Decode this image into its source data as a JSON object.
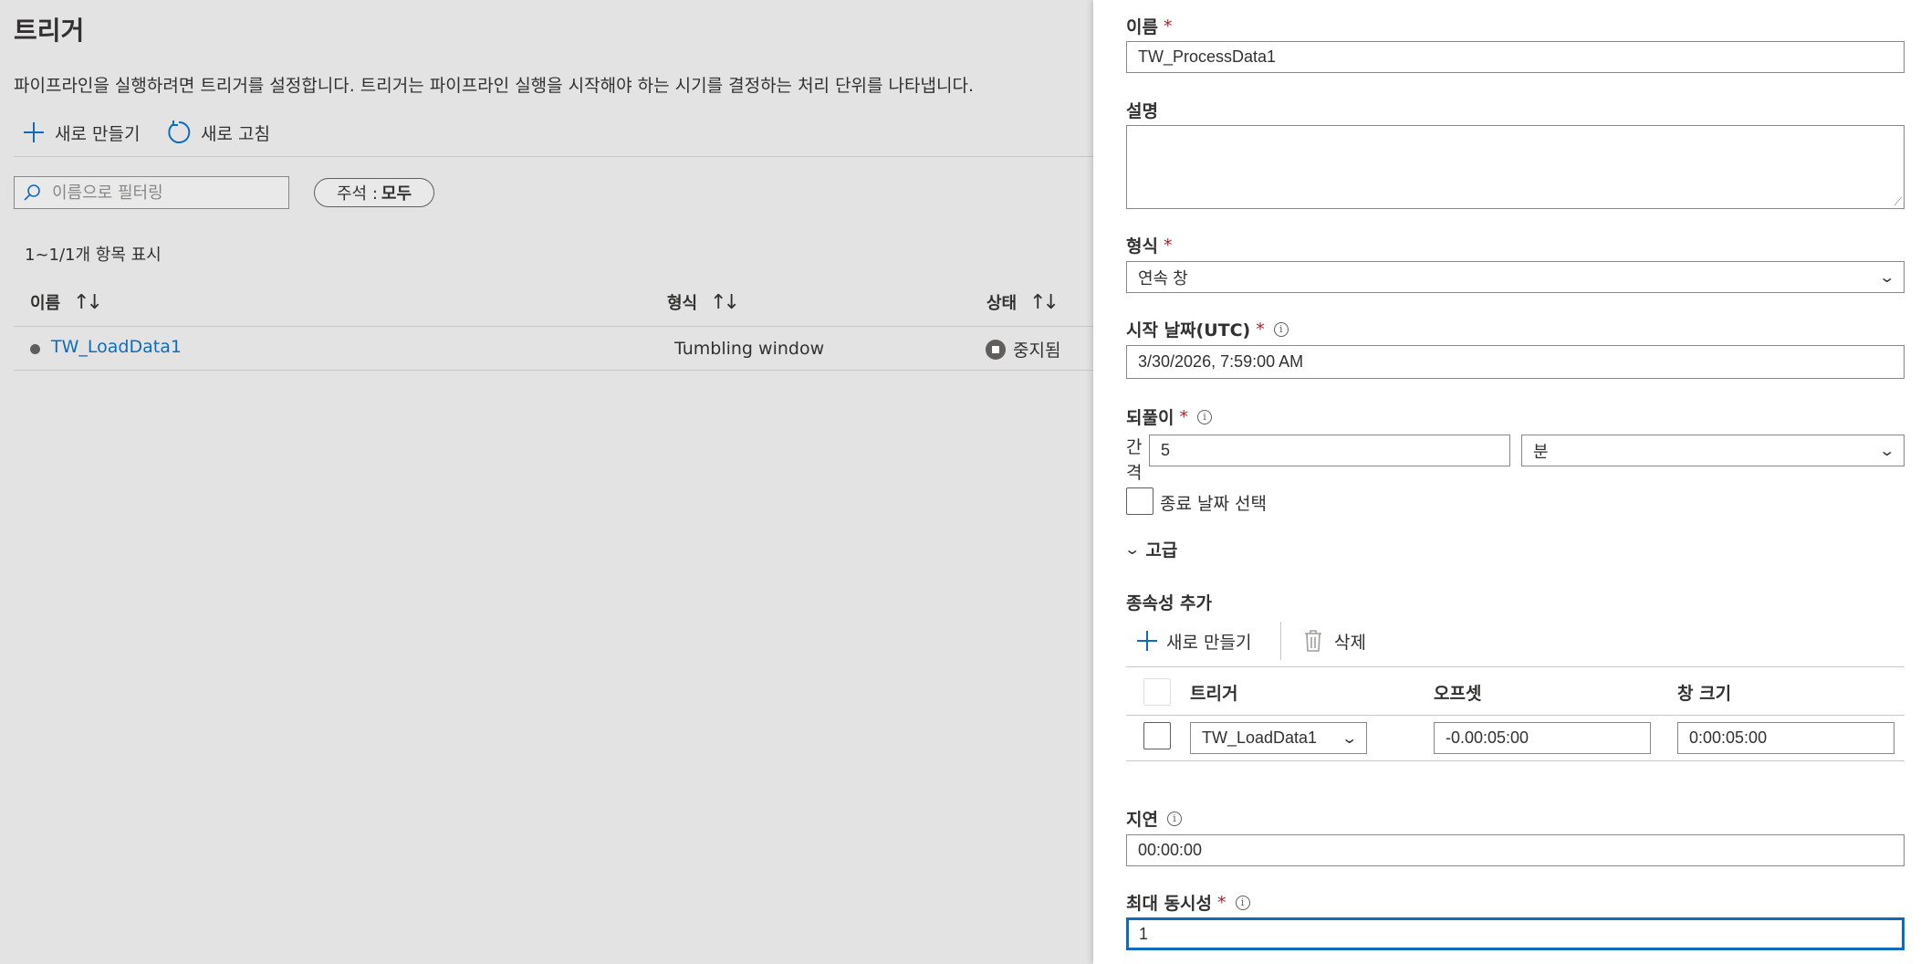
{
  "left": {
    "title": "트리거",
    "description": "파이프라인을 실행하려면 트리거를 설정합니다. 트리거는 파이프라인 실행을 시작해야 하는 시기를 결정하는 처리 단위를 나타냅니다.",
    "toolbar": {
      "new_label": "새로 만들기",
      "refresh_label": "새로 고침"
    },
    "filter": {
      "placeholder": "이름으로 필터링",
      "value": ""
    },
    "annotation_pill": {
      "label": "주석 : ",
      "value": "모두"
    },
    "count_text": "1~1/1개 항목 표시",
    "table": {
      "columns": [
        "이름",
        "형식",
        "상태"
      ],
      "rows": [
        {
          "name": "TW_LoadData1",
          "type": "Tumbling window",
          "status": "중지됨"
        }
      ]
    }
  },
  "panel": {
    "name": {
      "label": "이름",
      "value": "TW_ProcessData1"
    },
    "description": {
      "label": "설명",
      "value": ""
    },
    "type": {
      "label": "형식",
      "value": "연속 창"
    },
    "start_date": {
      "label": "시작 날짜(UTC)",
      "value": "3/30/2026, 7:59:00 AM"
    },
    "recurrence": {
      "label": "되풀이",
      "interval_label": "간격",
      "interval_value": "5",
      "unit_value": "분"
    },
    "end_date": {
      "label": "종료 날짜 선택",
      "checked": false
    },
    "advanced": {
      "label": "고급"
    },
    "dependency": {
      "title": "종속성 추가",
      "new_label": "새로 만들기",
      "delete_label": "삭제",
      "columns": [
        "트리거",
        "오프셋",
        "창 크기"
      ],
      "rows": [
        {
          "trigger": "TW_LoadData1",
          "offset": "-0.00:05:00",
          "window_size": "0:00:05:00"
        }
      ]
    },
    "delay": {
      "label": "지연",
      "value": "00:00:00"
    },
    "max_concurrency": {
      "label": "최대 동시성",
      "value": "1"
    },
    "required_mark": "*",
    "info_glyph": "i"
  },
  "colors": {
    "accent": "#0f6cbd",
    "required": "#a4262c",
    "overlay": "#e3e3e3"
  }
}
